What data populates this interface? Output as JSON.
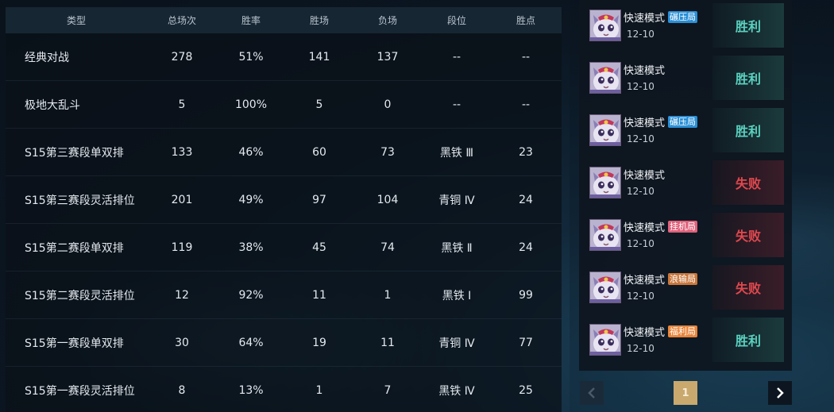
{
  "stats_table": {
    "headers": [
      "类型",
      "总场次",
      "胜率",
      "胜场",
      "负场",
      "段位",
      "胜点"
    ],
    "rows": [
      [
        "经典对战",
        "278",
        "51%",
        "141",
        "137",
        "--",
        "--"
      ],
      [
        "极地大乱斗",
        "5",
        "100%",
        "5",
        "0",
        "--",
        "--"
      ],
      [
        "S15第三赛段单双排",
        "133",
        "46%",
        "60",
        "73",
        "黑铁 Ⅲ",
        "23"
      ],
      [
        "S15第三赛段灵活排位",
        "201",
        "49%",
        "97",
        "104",
        "青铜 Ⅳ",
        "24"
      ],
      [
        "S15第二赛段单双排",
        "119",
        "38%",
        "45",
        "74",
        "黑铁 Ⅱ",
        "24"
      ],
      [
        "S15第二赛段灵活排位",
        "12",
        "92%",
        "11",
        "1",
        "黑铁 Ⅰ",
        "99"
      ],
      [
        "S15第一赛段单双排",
        "30",
        "64%",
        "19",
        "11",
        "青铜 Ⅳ",
        "77"
      ],
      [
        "S15第一赛段灵活排位",
        "8",
        "13%",
        "1",
        "7",
        "黑铁 Ⅳ",
        "25"
      ]
    ]
  },
  "match_history": {
    "items": [
      {
        "mode": "快速模式",
        "badge": "碾压局",
        "badge_color": "#2a8fd6",
        "date": "12-10",
        "result": "胜利",
        "outcome": "win"
      },
      {
        "mode": "快速模式",
        "badge": "",
        "badge_color": "",
        "date": "12-10",
        "result": "胜利",
        "outcome": "win"
      },
      {
        "mode": "快速模式",
        "badge": "碾压局",
        "badge_color": "#2a8fd6",
        "date": "12-10",
        "result": "胜利",
        "outcome": "win"
      },
      {
        "mode": "快速模式",
        "badge": "",
        "badge_color": "",
        "date": "12-10",
        "result": "失败",
        "outcome": "lose"
      },
      {
        "mode": "快速模式",
        "badge": "挂机局",
        "badge_color": "#e0607a",
        "date": "12-10",
        "result": "失败",
        "outcome": "lose"
      },
      {
        "mode": "快速模式",
        "badge": "浪输局",
        "badge_color": "#c9763a",
        "date": "12-10",
        "result": "失败",
        "outcome": "lose"
      },
      {
        "mode": "快速模式",
        "badge": "福利局",
        "badge_color": "#e9843a",
        "date": "12-10",
        "result": "胜利",
        "outcome": "win"
      }
    ],
    "champion_icon": "yuumi-cat-portrait-icon"
  },
  "pagination": {
    "current_page": "1",
    "prev_icon": "chevron-left-icon",
    "next_icon": "chevron-right-icon"
  }
}
